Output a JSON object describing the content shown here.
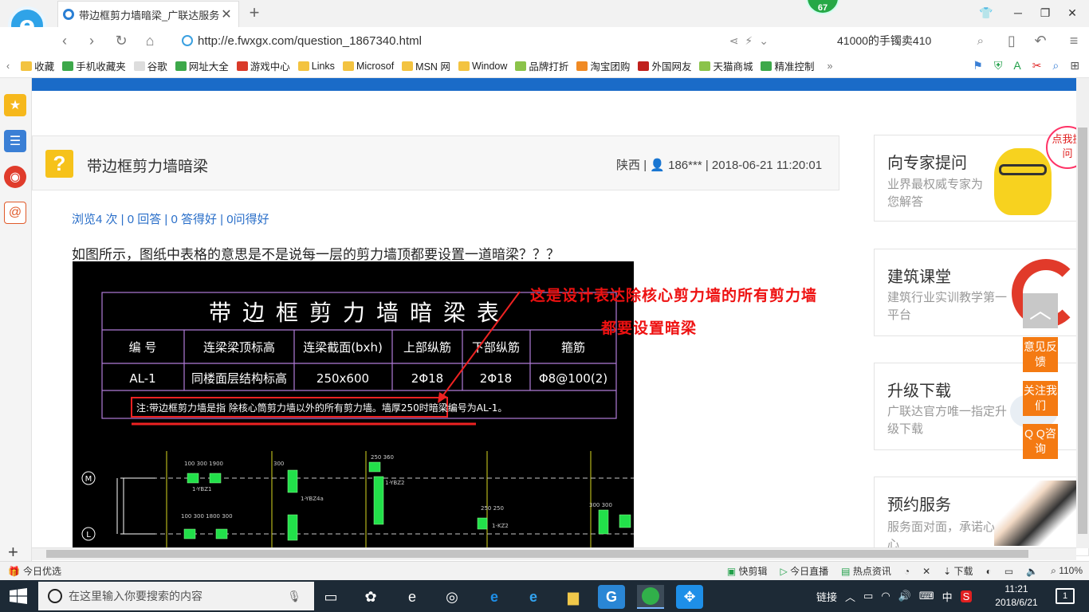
{
  "tab": {
    "title": "带边框剪力墙暗梁_广联达服务新"
  },
  "badge": "67",
  "address": {
    "url": "http://e.fwxgx.com/question_1867340.html",
    "search_text": "41000的手镯卖410"
  },
  "bookmarks": [
    {
      "label": "收藏",
      "color": "#f3c340"
    },
    {
      "label": "手机收藏夹",
      "color": "#3da84a"
    },
    {
      "label": "谷歌",
      "color": "#dddddd"
    },
    {
      "label": "网址大全",
      "color": "#3da84a"
    },
    {
      "label": "游戏中心",
      "color": "#d93a2a"
    },
    {
      "label": "Links",
      "color": "#f3c340"
    },
    {
      "label": "Microsof",
      "color": "#f3c340"
    },
    {
      "label": "MSN 网",
      "color": "#f3c340"
    },
    {
      "label": "Window",
      "color": "#f3c340"
    },
    {
      "label": "品牌打折",
      "color": "#8bc34a"
    },
    {
      "label": "淘宝团购",
      "color": "#f08a24"
    },
    {
      "label": "外国网友",
      "color": "#c0201c"
    },
    {
      "label": "天猫商城",
      "color": "#8bc34a"
    },
    {
      "label": "精准控制",
      "color": "#3da84a"
    }
  ],
  "question": {
    "title": "带边框剪力墙暗梁",
    "region": "陕西",
    "user": "186***",
    "datetime": "2018-06-21 11:20:01",
    "stats": "浏览4 次 | 0 回答 | 0 答得好 | 0问得好",
    "body": "如图所示，图纸中表格的意思是不是说每一层的剪力墙顶都要设置一道暗梁？？？"
  },
  "cad": {
    "table_title": "带边框剪力墙暗梁表",
    "headers": [
      "编 号",
      "连梁梁顶标高",
      "连梁截面(bxh)",
      "上部纵筋",
      "下部纵筋",
      "箍筋"
    ],
    "row": [
      "AL-1",
      "同楼面层结构标高",
      "250x600",
      "2Φ18",
      "2Φ18",
      "Φ8@100(2)"
    ],
    "note": "注:带边框剪力墙是指 除核心筒剪力墙以外的所有剪力墙。墙厚250时暗梁编号为AL-1。",
    "axis_labels": [
      "M",
      "L"
    ]
  },
  "annotation": {
    "line1": "这是设计表达除核心剪力墙的所有剪力墙",
    "line2": "都要设置暗梁"
  },
  "right_cards": [
    {
      "title": "向专家提问",
      "sub": "业界最权威专家为您解答",
      "bubble": "点我提问"
    },
    {
      "title": "建筑课堂",
      "sub": "建筑行业实训教学第一平台"
    },
    {
      "title": "升级下载",
      "sub": "广联达官方唯一指定升级下载"
    },
    {
      "title": "预约服务",
      "sub": "服务面对面，承诺心连心"
    }
  ],
  "float_buttons": [
    "意见反馈",
    "关注我们",
    "Q Q咨询"
  ],
  "statusbar": {
    "left": "今日优选",
    "items": [
      "快剪辑",
      "今日直播",
      "热点资讯",
      "下载"
    ],
    "zoom": "110%"
  },
  "taskbar": {
    "search_placeholder": "在这里输入你要搜索的内容",
    "link_label": "链接",
    "ime": "中",
    "time": "11:21",
    "date": "2018/6/21",
    "notifications": "1"
  },
  "colors": {
    "accent": "#1a6bc8",
    "orange": "#f47a12",
    "annotation": "#ee1111"
  }
}
